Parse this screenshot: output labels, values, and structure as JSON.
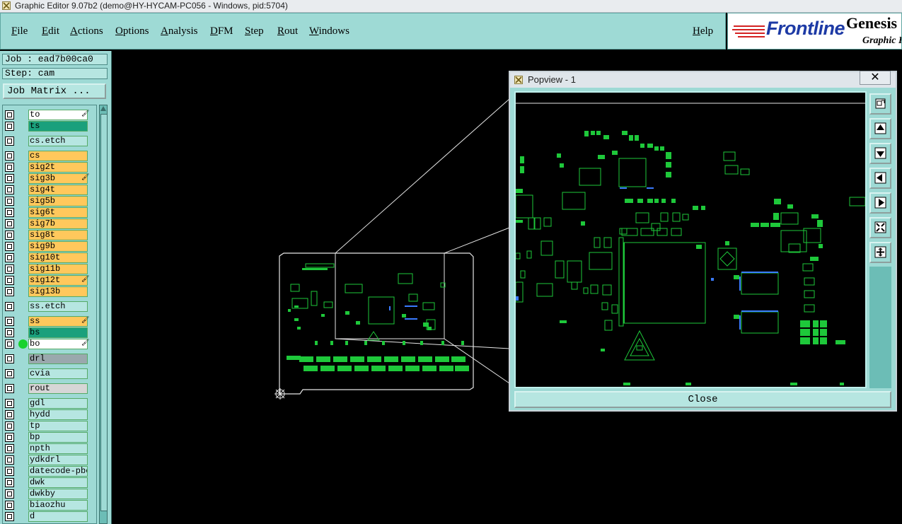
{
  "window": {
    "title": "Graphic Editor 9.07b2 (demo@HY-HYCAM-PC056 - Windows, pid:5704)"
  },
  "menu": {
    "items": [
      "File",
      "Edit",
      "Actions",
      "Options",
      "Analysis",
      "DFM",
      "Step",
      "Rout",
      "Windows"
    ],
    "help": "Help"
  },
  "logo": {
    "brand": "Frontline",
    "product": "Genesis",
    "subtitle": "Graphic E"
  },
  "job": {
    "job_label": "Job : ead7b00ca0",
    "step_label": "Step: cam",
    "matrix_button": "Job Matrix ..."
  },
  "layers": [
    {
      "name": "to",
      "color": "#ffffff",
      "mark": true
    },
    {
      "name": "ts",
      "color": "#1aa07c",
      "mark": false
    },
    {
      "name": "cs.etch",
      "color": "#b6e6e1",
      "mark": false
    },
    {
      "name": "cs",
      "color": "#ffc85c",
      "mark": false
    },
    {
      "name": "sig2t",
      "color": "#ffc85c",
      "mark": false
    },
    {
      "name": "sig3b",
      "color": "#ffc85c",
      "mark": true
    },
    {
      "name": "sig4t",
      "color": "#ffc85c",
      "mark": false
    },
    {
      "name": "sig5b",
      "color": "#ffc85c",
      "mark": false
    },
    {
      "name": "sig6t",
      "color": "#ffc85c",
      "mark": false
    },
    {
      "name": "sig7b",
      "color": "#ffc85c",
      "mark": false
    },
    {
      "name": "sig8t",
      "color": "#ffc85c",
      "mark": false
    },
    {
      "name": "sig9b",
      "color": "#ffc85c",
      "mark": false
    },
    {
      "name": "sig10t",
      "color": "#ffc85c",
      "mark": false
    },
    {
      "name": "sig11b",
      "color": "#ffc85c",
      "mark": false
    },
    {
      "name": "sig12t",
      "color": "#ffc85c",
      "mark": true
    },
    {
      "name": "sig13b",
      "color": "#ffc85c",
      "mark": false
    },
    {
      "name": "ss.etch",
      "color": "#b6e6e1",
      "mark": false
    },
    {
      "name": "ss",
      "color": "#ffc85c",
      "mark": true
    },
    {
      "name": "bs",
      "color": "#1aa07c",
      "mark": false
    },
    {
      "name": "bo",
      "color": "#ffffff",
      "mark": true,
      "active": true
    },
    {
      "name": "drl",
      "color": "#9aa8ad",
      "mark": false
    },
    {
      "name": "cvia",
      "color": "#b6e6e1",
      "mark": false
    },
    {
      "name": "rout",
      "color": "#d6d6d6",
      "mark": false
    },
    {
      "name": "gdl",
      "color": "#b6e6e1",
      "mark": false
    },
    {
      "name": "hydd",
      "color": "#b6e6e1",
      "mark": false
    },
    {
      "name": "tp",
      "color": "#b6e6e1",
      "mark": false
    },
    {
      "name": "bp",
      "color": "#b6e6e1",
      "mark": false
    },
    {
      "name": "npth",
      "color": "#b6e6e1",
      "mark": false
    },
    {
      "name": "ydkdrl",
      "color": "#b6e6e1",
      "mark": false
    },
    {
      "name": "datecode-pbe",
      "color": "#b6e6e1",
      "mark": false
    },
    {
      "name": "dwk",
      "color": "#b6e6e1",
      "mark": false
    },
    {
      "name": "dwkby",
      "color": "#b6e6e1",
      "mark": false
    },
    {
      "name": "biaozhu",
      "color": "#b6e6e1",
      "mark": false
    },
    {
      "name": "d",
      "color": "#b6e6e1",
      "mark": false
    }
  ],
  "popview": {
    "title": "Popview - 1",
    "close_button": "Close",
    "close_x": "✕"
  },
  "toolbar_icons": [
    "zoom-fit-icon",
    "pan-up-icon",
    "pan-down-icon",
    "pan-left-icon",
    "pan-right-icon",
    "zoom-out-icon",
    "zoom-in-icon"
  ],
  "colors": {
    "panel": "#9edad5",
    "board": "#1ec83a",
    "signal_layer": "#ffc85c",
    "mask_layer": "#1aa07c"
  }
}
